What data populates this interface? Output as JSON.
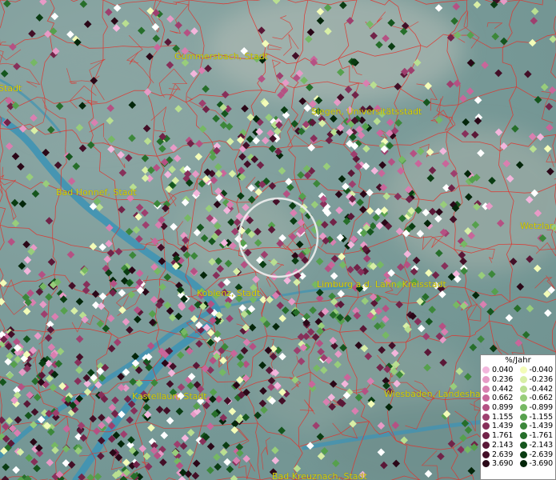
{
  "map": {
    "cities": [
      {
        "id": "gummersbach",
        "label": "Gummersbach, Stadt"
      },
      {
        "id": "siegen",
        "label": "Siegen, Universitätsstadt"
      },
      {
        "id": "bad-honnef",
        "label": "Bad Honnef, Stadt"
      },
      {
        "id": "wetzlar",
        "label": "Wetzlar, S"
      },
      {
        "id": "koblenz",
        "label": "Koblenz, Stadt"
      },
      {
        "id": "limburg",
        "label": "Limburg a.d. Lahn, Kreisstadt"
      },
      {
        "id": "kastellaun",
        "label": "Kastellaun, Stadt"
      },
      {
        "id": "wiesbaden",
        "label": "Wiesbaden, Landeshaup"
      },
      {
        "id": "bad-kreuznach",
        "label": "Bad Kreuznach, Stadt"
      },
      {
        "id": "left-stadt",
        "label": "Stadt"
      }
    ],
    "colors": {
      "river": "#3f93b4",
      "borders": "#e0322b",
      "city_label": "#d6d200",
      "selection_circle": "#f0f0f0"
    }
  },
  "legend": {
    "title": "%/Jahr",
    "positive": [
      {
        "value": "0.040",
        "color": "#f3b6dc"
      },
      {
        "value": "0.236",
        "color": "#e79ac6"
      },
      {
        "value": "0.442",
        "color": "#d97fb0"
      },
      {
        "value": "0.662",
        "color": "#c9669a"
      },
      {
        "value": "0.899",
        "color": "#b55183"
      },
      {
        "value": "1.155",
        "color": "#9e3f6e"
      },
      {
        "value": "1.439",
        "color": "#87305a"
      },
      {
        "value": "1.761",
        "color": "#712348"
      },
      {
        "value": "2.143",
        "color": "#5a1837"
      },
      {
        "value": "2.639",
        "color": "#430f27"
      },
      {
        "value": "3.690",
        "color": "#2a0717"
      }
    ],
    "negative": [
      {
        "value": "-0.040",
        "color": "#f3fcb8"
      },
      {
        "value": "-0.236",
        "color": "#d8efa6"
      },
      {
        "value": "-0.442",
        "color": "#b9df91"
      },
      {
        "value": "-0.662",
        "color": "#98cd7b"
      },
      {
        "value": "-0.899",
        "color": "#76b864"
      },
      {
        "value": "-1.155",
        "color": "#56a04d"
      },
      {
        "value": "-1.439",
        "color": "#3c873a"
      },
      {
        "value": "-1.761",
        "color": "#266e2a"
      },
      {
        "value": "-2.143",
        "color": "#15551d"
      },
      {
        "value": "-2.639",
        "color": "#0a3c12"
      },
      {
        "value": "-3.690",
        "color": "#04260a"
      }
    ]
  }
}
